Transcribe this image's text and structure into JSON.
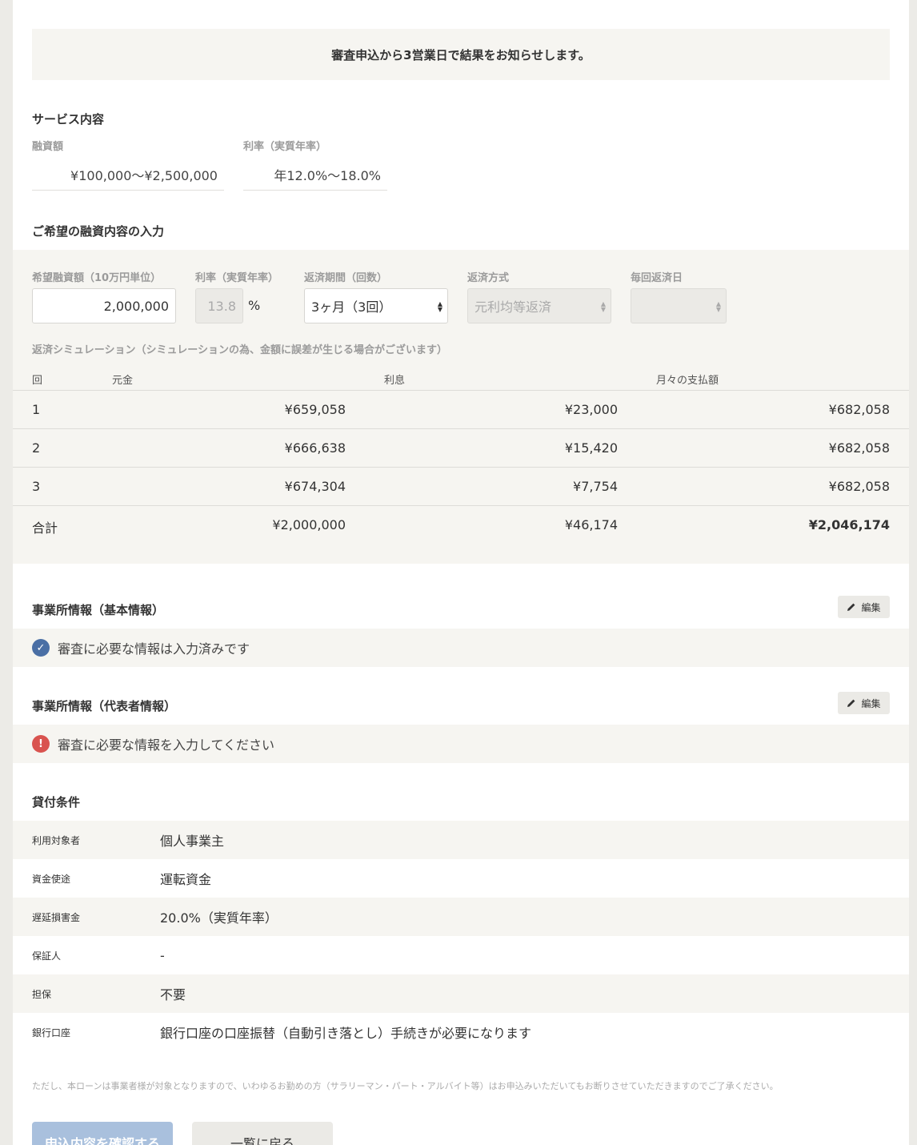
{
  "notice": "審査申込から3営業日で結果をお知らせします。",
  "service": {
    "title": "サービス内容",
    "loan_label": "融資額",
    "loan_value": "¥100,000〜¥2,500,000",
    "rate_label": "利率（実質年率）",
    "rate_value": "年12.0%〜18.0%"
  },
  "input_section": {
    "title": "ご希望の融資内容の入力",
    "amount_label": "希望融資額（10万円単位）",
    "amount_value": "2,000,000",
    "rate_label": "利率（実質年率）",
    "rate_value": "13.8",
    "rate_unit": "%",
    "period_label": "返済期間（回数）",
    "period_value": "3ヶ月（3回）",
    "method_label": "返済方式",
    "method_value": "元利均等返済",
    "day_label": "毎回返済日",
    "day_value": ""
  },
  "simulation": {
    "caption": "返済シミュレーション（シミュレーションの為、金額に誤差が生じる場合がございます）",
    "headers": [
      "回",
      "元金",
      "利息",
      "月々の支払額"
    ],
    "rows": [
      [
        "1",
        "¥659,058",
        "¥23,000",
        "¥682,058"
      ],
      [
        "2",
        "¥666,638",
        "¥15,420",
        "¥682,058"
      ],
      [
        "3",
        "¥674,304",
        "¥7,754",
        "¥682,058"
      ]
    ],
    "total": [
      "合計",
      "¥2,000,000",
      "¥46,174",
      "¥2,046,174"
    ]
  },
  "office_basic": {
    "title": "事業所情報（基本情報）",
    "edit_label": "編集",
    "status": "審査に必要な情報は入力済みです",
    "status_color": "#4a6fa5"
  },
  "office_rep": {
    "title": "事業所情報（代表者情報）",
    "edit_label": "編集",
    "status": "審査に必要な情報を入力してください",
    "status_color": "#d9534f"
  },
  "conditions": {
    "title": "貸付条件",
    "rows": [
      {
        "key": "利用対象者",
        "value": "個人事業主"
      },
      {
        "key": "資金使途",
        "value": "運転資金"
      },
      {
        "key": "遅延損害金",
        "value": "20.0%（実質年率）"
      },
      {
        "key": "保証人",
        "value": "-"
      },
      {
        "key": "担保",
        "value": "不要"
      },
      {
        "key": "銀行口座",
        "value": "銀行口座の口座振替（自動引き落とし）手続きが必要になります"
      }
    ]
  },
  "footnote": "ただし、本ローンは事業者様が対象となりますので、いわゆるお勤めの方（サラリーマン・パート・アルバイト等）はお申込みいただいてもお断りさせていただきますのでご了承ください。",
  "buttons": {
    "confirm": "申込内容を確認する",
    "back": "一覧に戻る"
  },
  "colors": {
    "accent_blue": "#4a6fa5",
    "error_red": "#d9534f",
    "panel_bg": "#f6f5f1",
    "confirm_button_bg": "#a9c0dd"
  }
}
